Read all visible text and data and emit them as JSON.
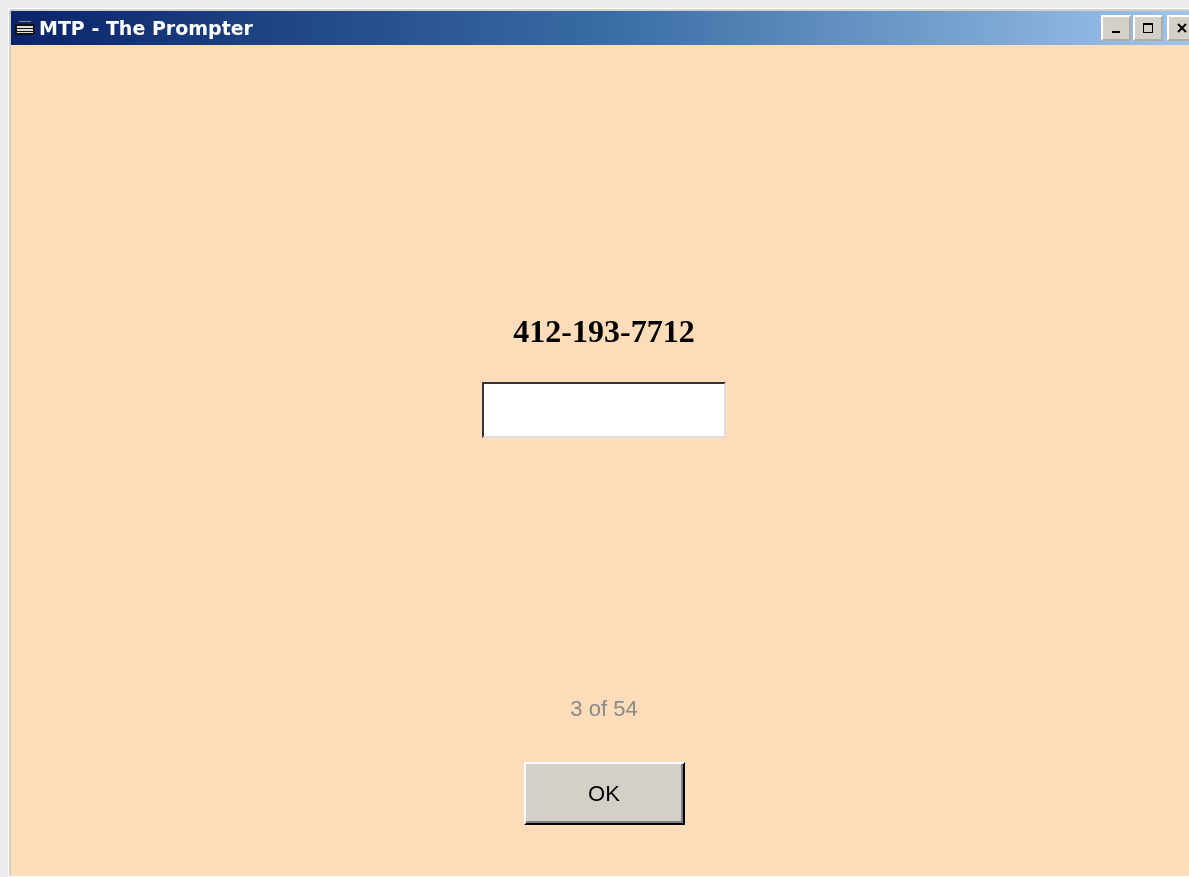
{
  "window": {
    "title": "MTP - The Prompter"
  },
  "prompt": "412-193-7712",
  "counter": "3 of 54",
  "buttons": [
    "OK"
  ]
}
